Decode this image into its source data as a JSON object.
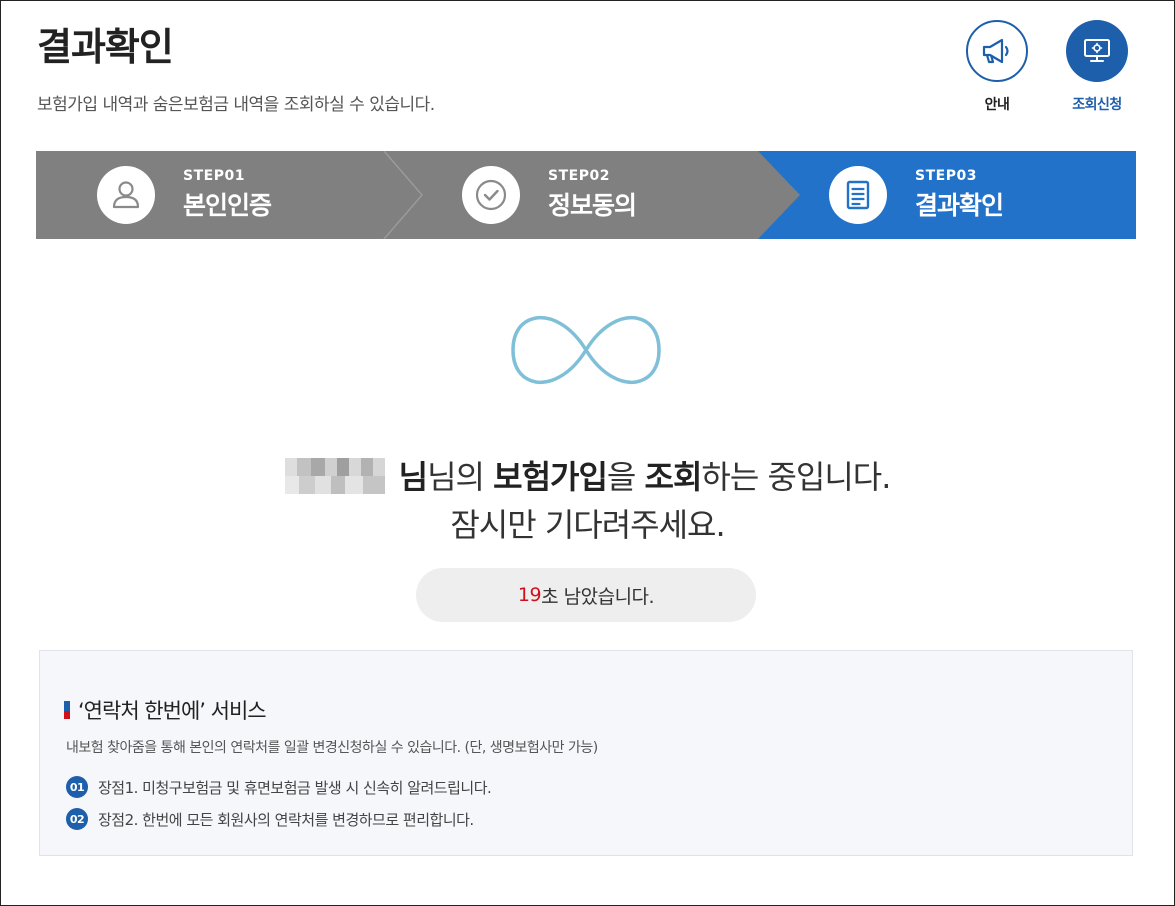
{
  "header": {
    "title": "결과확인",
    "subtitle": "보험가입 내역과 숨은보험금 내역을 조회하실 수 있습니다.",
    "buttons": {
      "guide": {
        "label": "안내",
        "icon": "megaphone-icon"
      },
      "apply": {
        "label": "조회신청",
        "icon": "monitor-settings-icon"
      }
    }
  },
  "steps": [
    {
      "num": "STEP01",
      "name": "본인인증",
      "icon": "user-icon",
      "active": false
    },
    {
      "num": "STEP02",
      "name": "정보동의",
      "icon": "check-circle-icon",
      "active": false
    },
    {
      "num": "STEP03",
      "name": "결과확인",
      "icon": "document-icon",
      "active": true
    }
  ],
  "message": {
    "part1": "님의 ",
    "bold1": "보험가입",
    "part2": "을 ",
    "bold2": "조회",
    "part3": "하는 중입니다.",
    "line2": "잠시만 기다려주세요."
  },
  "timer": {
    "seconds": "19",
    "suffix": "초 남았습니다."
  },
  "info": {
    "title": "‘연락처 한번에’ 서비스",
    "desc": "내보험 찾아줌을 통해 본인의 연락처를 일괄 변경신청하실 수 있습니다. (단, 생명보험사만 가능)",
    "points": [
      {
        "badge": "01",
        "text": "장점1. 미청구보험금 및 휴면보험금 발생 시 신속히 알려드립니다."
      },
      {
        "badge": "02",
        "text": "장점2. 한번에 모든 회원사의 연락처를 변경하므로 편리합니다."
      }
    ]
  },
  "colors": {
    "accent": "#1d5fab",
    "step_active": "#2372c9",
    "step_inactive": "#808080",
    "timer_number": "#d0101b",
    "loader": "#7fc0d8"
  }
}
